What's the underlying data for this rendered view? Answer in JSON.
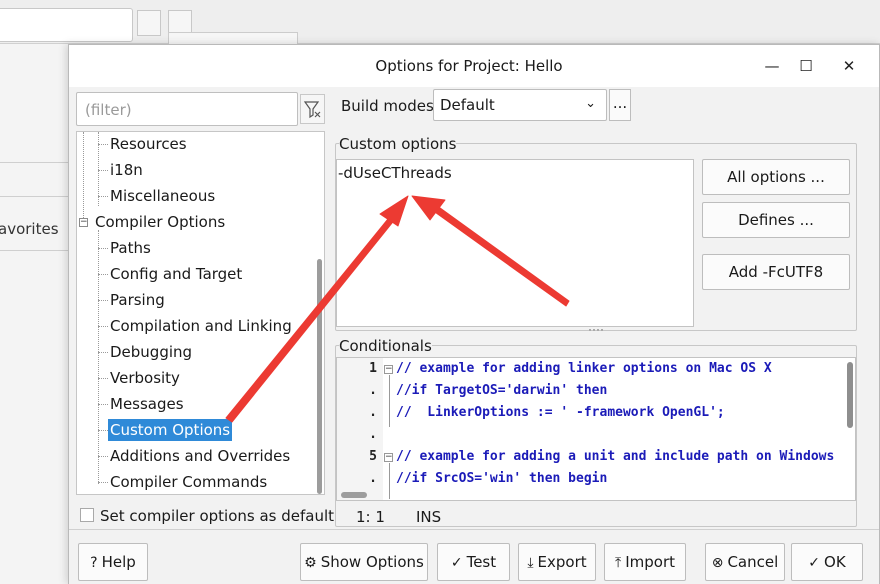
{
  "background": {
    "favorites_label": "avorites"
  },
  "dialog": {
    "title": "Options for Project: Hello",
    "controls": {
      "minimize": "—",
      "maximize": "☐",
      "close": "✕"
    }
  },
  "filter": {
    "placeholder": "(filter)"
  },
  "tree": {
    "items": [
      {
        "label": "Resources"
      },
      {
        "label": "i18n"
      },
      {
        "label": "Miscellaneous"
      },
      {
        "label": "Compiler Options"
      },
      {
        "label": "Paths"
      },
      {
        "label": "Config and Target"
      },
      {
        "label": "Parsing"
      },
      {
        "label": "Compilation and Linking"
      },
      {
        "label": "Debugging"
      },
      {
        "label": "Verbosity"
      },
      {
        "label": "Messages"
      },
      {
        "label": "Custom Options"
      },
      {
        "label": "Additions and Overrides"
      },
      {
        "label": "Compiler Commands"
      }
    ],
    "selected": "Custom Options"
  },
  "set_default_label": "Set compiler options as default",
  "build_modes": {
    "label": "Build modes",
    "value": "Default",
    "more": "..."
  },
  "custom_options": {
    "title": "Custom options",
    "text": "-dUseCThreads",
    "buttons": {
      "all": "All options ...",
      "defines": "Defines ...",
      "add": "Add -FcUTF8"
    }
  },
  "conditionals": {
    "title": "Conditionals",
    "gutter": [
      "1",
      ".",
      ".",
      ".",
      "5",
      "."
    ],
    "lines": [
      "// example for adding linker options on Mac OS X",
      "//if TargetOS='darwin' then",
      "//  LinkerOptions := ' -framework OpenGL';",
      "",
      "// example for adding a unit and include path on Windows",
      "//if SrcOS='win' then begin"
    ],
    "status": {
      "pos": "1: 1",
      "mode": "INS"
    }
  },
  "footer": {
    "help": "Help",
    "show_options": "Show Options",
    "test": "Test",
    "export": "Export",
    "import": "Import",
    "cancel": "Cancel",
    "ok": "OK"
  },
  "colors": {
    "selection": "#2f8ad8",
    "annotation_arrow": "#ec3a32",
    "code": "#1b1bb8"
  }
}
